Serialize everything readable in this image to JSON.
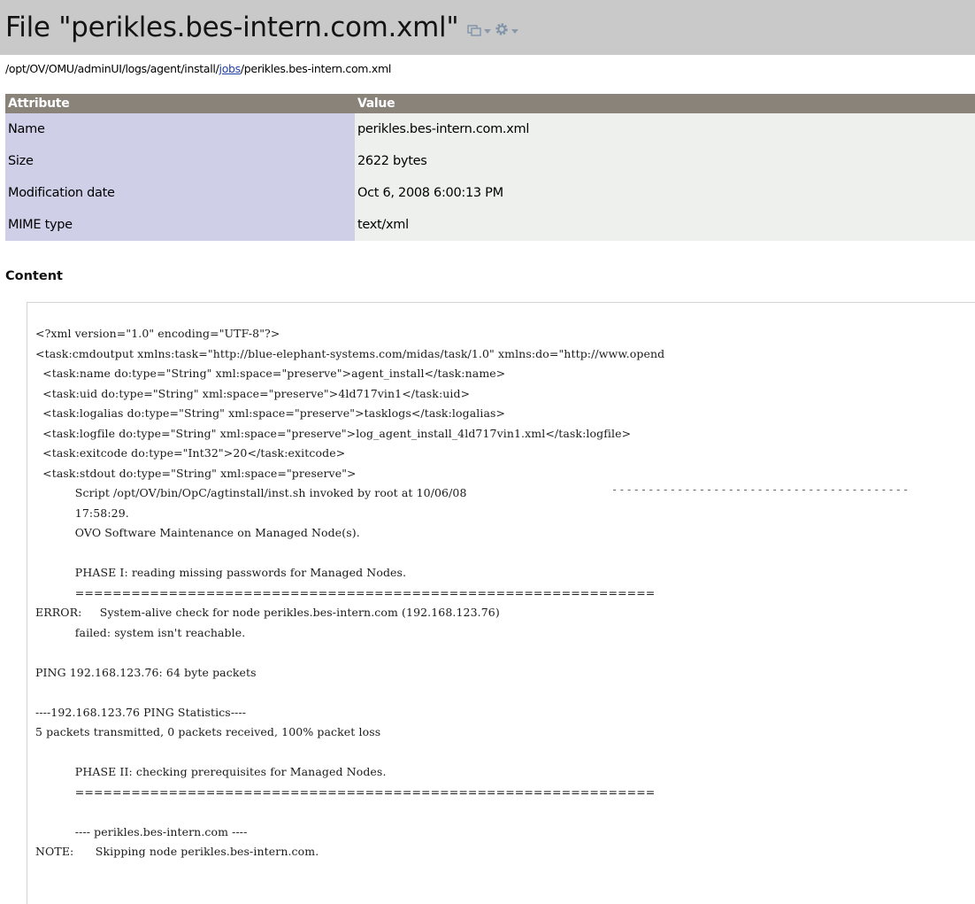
{
  "header": {
    "title": "File \"perikles.bes-intern.com.xml\""
  },
  "path": {
    "prefix": "/opt/OV/OMU/adminUI/logs/agent/install/",
    "link": "jobs",
    "suffix": "/perikles.bes-intern.com.xml"
  },
  "attributes": {
    "headers": [
      "Attribute",
      "Value"
    ],
    "rows": [
      {
        "attribute": "Name",
        "value": "perikles.bes-intern.com.xml"
      },
      {
        "attribute": "Size",
        "value": "2622 bytes"
      },
      {
        "attribute": "Modification date",
        "value": "Oct 6, 2008 6:00:13 PM"
      },
      {
        "attribute": "MIME type",
        "value": "text/xml"
      }
    ]
  },
  "content": {
    "heading": "Content",
    "lines": [
      "<?xml version=\"1.0\" encoding=\"UTF-8\"?>",
      "<task:cmdoutput xmlns:task=\"http://blue-elephant-systems.com/midas/task/1.0\" xmlns:do=\"http://www.opend",
      "  <task:name do:type=\"String\" xml:space=\"preserve\">agent_install</task:name>",
      "  <task:uid do:type=\"String\" xml:space=\"preserve\">4ld717vin1</task:uid>",
      "  <task:logalias do:type=\"String\" xml:space=\"preserve\">tasklogs</task:logalias>",
      "  <task:logfile do:type=\"String\" xml:space=\"preserve\">log_agent_install_4ld717vin1.xml</task:logfile>",
      "  <task:exitcode do:type=\"Int32\">20</task:exitcode>",
      "  <task:stdout do:type=\"String\" xml:space=\"preserve\">",
      "           Script /opt/OV/bin/OpC/agtinstall/inst.sh invoked by root at 10/06/08",
      "           17:58:29.",
      "           OVO Software Maintenance on Managed Node(s).",
      "",
      "           PHASE I: reading missing passwords for Managed Nodes.",
      "           ==============================================================",
      "ERROR:     System-alive check for node perikles.bes-intern.com (192.168.123.76)",
      "           failed: system isn't reachable.",
      "",
      "PING 192.168.123.76: 64 byte packets",
      "",
      "----192.168.123.76 PING Statistics----",
      "5 packets transmitted, 0 packets received, 100% packet loss",
      "",
      "           PHASE II: checking prerequisites for Managed Nodes.",
      "           ==============================================================",
      "",
      "           ---- perikles.bes-intern.com ----",
      "NOTE:      Skipping node perikles.bes-intern.com."
    ],
    "stdout_separator": "-----------------------------------------"
  },
  "icons": {
    "view": "window-view-icon",
    "settings": "gear-icon"
  },
  "colors": {
    "title_bar": "#c9c9c9",
    "table_header": "#8a837a",
    "attribute_cell": "#cfcfe8",
    "value_cell": "#eef0ee",
    "link": "#1f3fa8"
  }
}
